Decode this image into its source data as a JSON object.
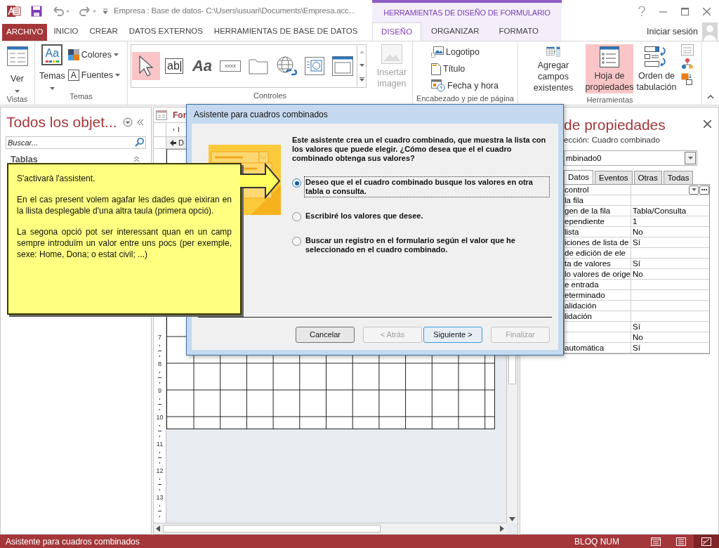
{
  "title_bar": {
    "title": "Empresa : Base de datos- C:\\Users\\usuari\\Documents\\Empresa.acc...",
    "context_header": "HERRAMIENTAS DE DISEÑO DE FORMULARIO"
  },
  "ribbon_tabs": [
    {
      "label": "ARCHIVO",
      "kind": "file",
      "selected": false
    },
    {
      "label": "INICIO",
      "kind": "normal",
      "selected": false
    },
    {
      "label": "CREAR",
      "kind": "normal",
      "selected": false
    },
    {
      "label": "DATOS EXTERNOS",
      "kind": "normal",
      "selected": false
    },
    {
      "label": "HERRAMIENTAS DE BASE DE DATOS",
      "kind": "normal",
      "selected": false
    },
    {
      "label": "DISEÑO",
      "kind": "contextual",
      "selected": true
    },
    {
      "label": "ORGANIZAR",
      "kind": "contextual",
      "selected": false
    },
    {
      "label": "FORMATO",
      "kind": "contextual",
      "selected": false
    }
  ],
  "account": {
    "label": "Iniciar sesión"
  },
  "ribbon": {
    "vistas": {
      "label": "Vistas",
      "button": "Ver"
    },
    "temas": {
      "label": "Temas",
      "button": "Temas",
      "icon_text": "Aa",
      "colors": "Colores",
      "fonts": "Fuentes",
      "fonts_icon_text": "A"
    },
    "controles": {
      "label": "Controles",
      "gallery": [
        {
          "kind": "pointer",
          "selected": true
        },
        {
          "kind": "textbox",
          "text": "ab",
          "selected": false
        },
        {
          "kind": "label",
          "text": "Aa",
          "selected": false
        },
        {
          "kind": "button",
          "text": "xxxx",
          "selected": false
        },
        {
          "kind": "tab",
          "selected": false
        },
        {
          "kind": "hyperlink",
          "selected": false
        },
        {
          "kind": "browser",
          "selected": false
        },
        {
          "kind": "navigation",
          "selected": false
        }
      ],
      "insert_image": {
        "label": "Insertar imagen",
        "disabled": true
      }
    },
    "encabezado": {
      "label": "Encabezado y pie de página",
      "items": [
        {
          "kind": "logo",
          "label": "Logotipo"
        },
        {
          "kind": "title",
          "label": "Título"
        },
        {
          "kind": "datetime",
          "label": "Fecha y hora"
        }
      ]
    },
    "herramientas": {
      "label": "Herramientas",
      "buttons": [
        {
          "kind": "fields",
          "label": "Agregar campos existentes",
          "selected": false
        },
        {
          "kind": "sheet",
          "label": "Hoja de propiedades",
          "selected": true
        },
        {
          "kind": "taborder",
          "label": "Orden de tabulación",
          "selected": false
        }
      ]
    }
  },
  "nav_pane": {
    "title": "Todos los objet...",
    "search_placeholder": "Buscar...",
    "section": "Tablas"
  },
  "document_tab": {
    "label": "For"
  },
  "form_designer": {
    "section": "D",
    "ruler_numbers": [
      "7",
      "8",
      "9",
      "10",
      "11",
      "12",
      "13"
    ]
  },
  "property_sheet": {
    "title": "de propiedades",
    "selection": "ección:  Cuadro combinado",
    "object": "mbinado0",
    "tabs": [
      {
        "label": "Datos",
        "selected": true
      },
      {
        "label": "Eventos",
        "selected": false
      },
      {
        "label": "Otras",
        "selected": false
      },
      {
        "label": "Todas",
        "selected": false
      }
    ],
    "rows": [
      {
        "kind": "builder",
        "name": "control",
        "value": ""
      },
      {
        "kind": "plain",
        "name": "la fila",
        "value": ""
      },
      {
        "kind": "plain",
        "name": "gen de la fila",
        "value": "Tabla/Consulta"
      },
      {
        "kind": "plain",
        "name": "ependiente",
        "value": "1"
      },
      {
        "kind": "plain",
        "name": "lista",
        "value": "No"
      },
      {
        "kind": "plain",
        "name": "iciones de lista de",
        "value": "Sí"
      },
      {
        "kind": "plain",
        "name": "de edición de ele",
        "value": ""
      },
      {
        "kind": "plain",
        "name": "ta de valores",
        "value": "Sí"
      },
      {
        "kind": "plain",
        "name": "lo valores de orige",
        "value": "No"
      },
      {
        "kind": "plain",
        "name": "e entrada",
        "value": ""
      },
      {
        "kind": "plain",
        "name": "eterminado",
        "value": ""
      },
      {
        "kind": "plain",
        "name": "alidación",
        "value": ""
      },
      {
        "kind": "plain",
        "name": "lidación",
        "value": ""
      },
      {
        "kind": "plain",
        "name": "",
        "value": "Sí"
      },
      {
        "kind": "plain",
        "name": "",
        "value": "No"
      },
      {
        "kind": "plain",
        "name": "automática",
        "value": "Sí"
      }
    ]
  },
  "dialog": {
    "title": "Asistente para cuadros combinados",
    "intro": "Este asistente crea un el cuadro combinado, que muestra la lista con los valores que puede elegir. ¿Cómo desea que el el cuadro combinado obtenga sus valores?",
    "options": [
      {
        "label": "Deseo que el el cuadro combinado busque los valores en otra tabla o consulta.",
        "selected": true,
        "focused": true
      },
      {
        "label": "Escribiré los valores que desee.",
        "selected": false,
        "focused": false
      },
      {
        "label": "Buscar un registro en el formulario según el valor que he seleccionado en el cuadro combinado.",
        "selected": false,
        "focused": false
      }
    ],
    "buttons": [
      {
        "label": "Cancelar",
        "disabled": false,
        "default": false
      },
      {
        "label": "< Atrás",
        "disabled": true,
        "default": false
      },
      {
        "label": "Siguiente >",
        "disabled": false,
        "default": true
      },
      {
        "label": "Finalizar",
        "disabled": true,
        "default": false
      }
    ]
  },
  "callout": {
    "paragraphs": [
      "S'activarà l'assistent.",
      "En el cas present volem agafar les dades que eixiran en la llista desplegable d'una altra taula (primera opció).",
      "La segona opció pot ser interessant quan en un camp sempre introduïm un valor entre uns pocs (per exemple, sexe: Home, Dona; o estat civil; ...)"
    ]
  },
  "status_bar": {
    "message": "Asistente para cuadros combinados",
    "indicator": "BLOQ NUM",
    "views": [
      {
        "kind": "form",
        "selected": false
      },
      {
        "kind": "layout",
        "selected": false
      },
      {
        "kind": "design",
        "selected": true
      }
    ]
  }
}
